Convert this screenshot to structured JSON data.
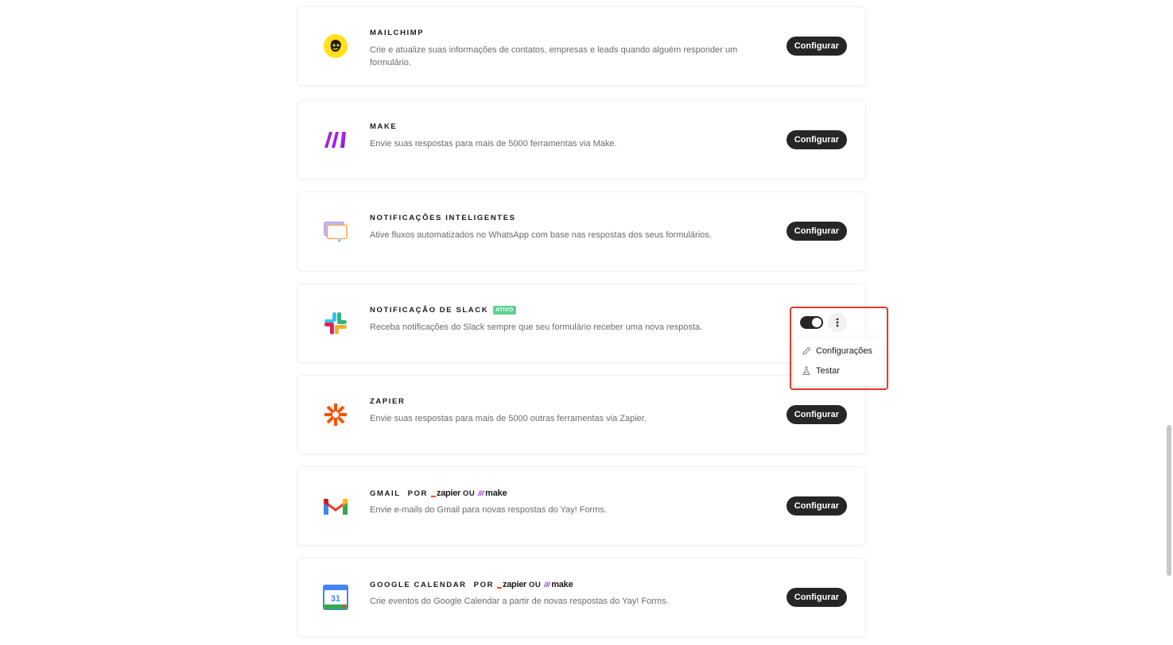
{
  "integrations": [
    {
      "title": "MAILCHIMP",
      "description": "Crie e atualize suas informações de contatos, empresas e leads quando alguém responder um formulário.",
      "button": "Configurar",
      "icon": "mailchimp-icon"
    },
    {
      "title": "MAKE",
      "description": "Envie suas respostas para mais de 5000 ferramentas via Make.",
      "button": "Configurar",
      "icon": "make-icon"
    },
    {
      "title": "NOTIFICAÇÕES INTELIGENTES",
      "description": "Ative fluxos automatizados no WhatsApp com base nas respostas dos seus formulários.",
      "button": "Configurar",
      "icon": "chat-bubbles-icon"
    },
    {
      "title": "NOTIFICAÇÃO DE SLACK",
      "badge": "ATIVO",
      "description": "Receba notificações do Slack sempre que seu formulário receber uma nova resposta.",
      "icon": "slack-icon",
      "toggle_on": true,
      "menu": [
        "Configurações",
        "Testar"
      ]
    },
    {
      "title": "ZAPIER",
      "description": "Envie suas respostas para mais de 5000 outras ferramentas via Zapier.",
      "button": "Configurar",
      "icon": "zapier-icon"
    },
    {
      "title": "GMAIL",
      "por": "POR",
      "zapier": "zapier",
      "ou": "OU",
      "make": "make",
      "description": "Envie e-mails do Gmail para novas respostas do Yay! Forms.",
      "button": "Configurar",
      "icon": "gmail-icon"
    },
    {
      "title": "GOOGLE CALENDAR",
      "por": "POR",
      "zapier": "zapier",
      "ou": "OU",
      "make": "make",
      "description": "Crie eventos do Google Calendar a partir de novas respostas do Yay! Forms.",
      "button": "Configurar",
      "icon": "google-calendar-icon",
      "calendar_day": "31"
    }
  ],
  "colors": {
    "button_bg": "#262626",
    "badge_active": "#5bd18d",
    "highlight": "#e03c2b",
    "zapier_orange": "#ff4f00",
    "make_purple": "#8a2be2"
  }
}
